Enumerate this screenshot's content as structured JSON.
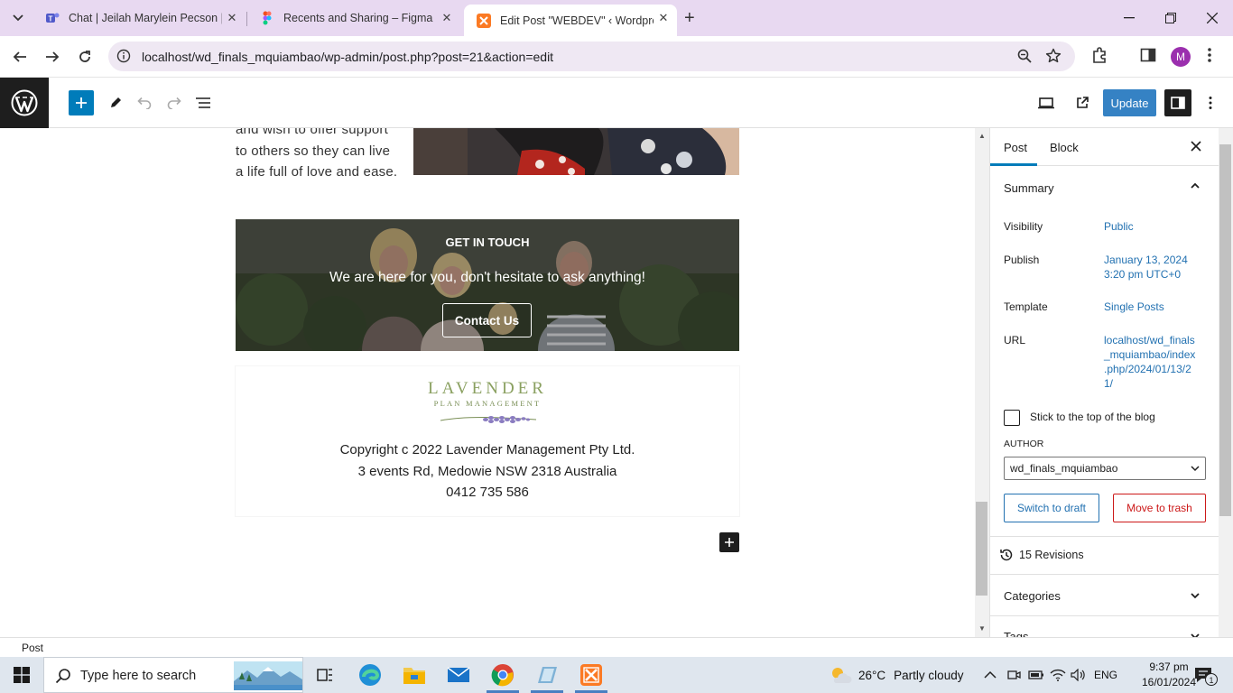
{
  "browser": {
    "tabs": [
      {
        "title": "Chat | Jeilah Marylein Pecson | Microsoft Teams",
        "icon": "teams-icon"
      },
      {
        "title": "Recents and Sharing – Figma",
        "icon": "figma-icon"
      },
      {
        "title": "Edit Post \"WEBDEV\" ‹ Wordpress",
        "icon": "xampp-icon",
        "active": true
      }
    ],
    "url": "localhost/wd_finals_mquiambao/wp-admin/post.php?post=21&action=edit",
    "profile_initial": "M"
  },
  "editor": {
    "update_label": "Update"
  },
  "content": {
    "intro_text": "and wish to offer support to others so they can live a life full of love and ease.",
    "cta": {
      "title": "GET IN TOUCH",
      "subtitle": "We are here for you, don't hesitate to ask anything!",
      "button": "Contact Us"
    },
    "footer": {
      "logo_name": "LAVENDER",
      "logo_tagline": "PLAN MANAGEMENT",
      "lines": [
        "Copyright c 2022 Lavender Management Pty Ltd.",
        "3 events Rd, Medowie NSW 2318 Australia",
        "0412 735 586"
      ]
    }
  },
  "sidebar": {
    "tabs": [
      "Post",
      "Block"
    ],
    "summary_title": "Summary",
    "rows": [
      {
        "label": "Visibility",
        "value": "Public"
      },
      {
        "label": "Publish",
        "value_lines": [
          "January 13, 2024",
          "3:20 pm UTC+0"
        ]
      },
      {
        "label": "Template",
        "value": "Single Posts"
      },
      {
        "label": "URL",
        "value_lines": [
          "localhost/wd_finals",
          "_mquiambao/index",
          ".php/2024/01/13/2",
          "1/"
        ]
      }
    ],
    "sticky_label": "Stick to the top of the blog",
    "author_label": "AUTHOR",
    "author_value": "wd_finals_mquiambao",
    "switch_draft": "Switch to draft",
    "move_trash": "Move to trash",
    "revisions": "15 Revisions",
    "categories": "Categories",
    "tags": "Tags"
  },
  "status_bar": {
    "breadcrumb": "Post"
  },
  "taskbar": {
    "search_placeholder": "Type here to search",
    "weather_temp": "26°C",
    "weather_text": "Partly cloudy",
    "language": "ENG",
    "time": "9:37 pm",
    "date": "16/01/2024",
    "notification_count": "1"
  },
  "colors": {
    "tabstrip": "#e8d9f1",
    "wp_blue": "#007cba",
    "update_blue": "#3582c4",
    "link": "#2271b1",
    "danger": "#cc1818",
    "logo_green": "#8aa060"
  }
}
